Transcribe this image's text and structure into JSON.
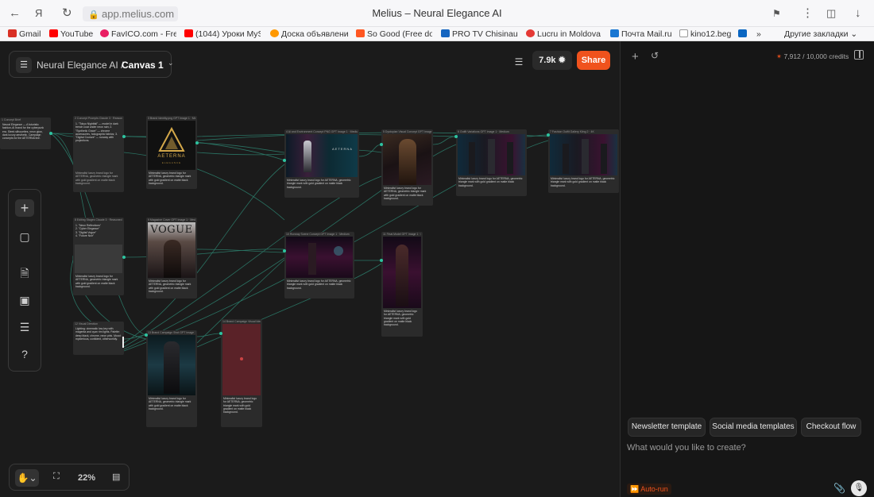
{
  "browser": {
    "url": "app.melius.com",
    "tab_title": "Melius – Neural Elegance AI",
    "bookmarks": [
      {
        "label": "Gmail",
        "color": "#d93025"
      },
      {
        "label": "YouTube",
        "color": "#ff0000"
      },
      {
        "label": "FavICO.com - Free",
        "color": "#e91e63"
      },
      {
        "label": "(1044) Уроки MyS",
        "color": "#ff0000"
      },
      {
        "label": "Доска объявлени",
        "color": "#ff9800"
      },
      {
        "label": "So Good (Free dov",
        "color": "#ff5722"
      },
      {
        "label": "PRO TV Chisinau |",
        "color": "#1565c0"
      },
      {
        "label": "Lucru in Moldova",
        "color": "#e53935"
      },
      {
        "label": "Почта Mail.ru",
        "color": "#1976d2"
      },
      {
        "label": "kino12.beg",
        "color": "#9e9e9e"
      },
      {
        "label": "",
        "color": "#0a66c2"
      }
    ],
    "more_bookmarks": "»",
    "other_bookmarks": "Другие закладки"
  },
  "header": {
    "project_name": "Neural Elegance AI /",
    "canvas_name": "Canvas 1",
    "credits_pill": "7.9k",
    "share_label": "Share"
  },
  "bottom_bar": {
    "zoom": "22%"
  },
  "right_panel": {
    "credits": "7,912 / 10,000 credits",
    "templates": [
      "Newsletter template",
      "Social media templates",
      "Checkout flow"
    ],
    "prompt_placeholder": "What would you like to create?",
    "autorun_label": "Auto-run"
  },
  "nodes": [
    {
      "name": "node-concept-brief",
      "header": "1 Concept Brief"
    },
    {
      "name": "node-concept-prompts",
      "header": "2 Concept Prompts    Claude 3 · Reasoned"
    },
    {
      "name": "node-brand-identity",
      "header": "3 Brand Identity.png    GPT Image 1 · Medium"
    },
    {
      "name": "node-cyber-character-1",
      "header": "4 Ai and Environment Concept PNG    GPT Image 1 · Medium"
    },
    {
      "name": "node-dystopian-visual",
      "header": "5 Dystopian Visual Concept    GPT Image 1 · Medium"
    },
    {
      "name": "node-outfit-variations-1",
      "header": "6 Outfit Variations    GPT Image 1 · Medium"
    },
    {
      "name": "node-outfit-variations-2",
      "header": "7 Fashion Outfit Gallery    Kling 2 · 4K"
    },
    {
      "name": "node-editing-stages",
      "header": "8 Editing Stages    Claude 3 · Reasoned"
    },
    {
      "name": "node-magazine-cover",
      "header": "9 Magazine Cover    GPT Image 1 · Medium"
    },
    {
      "name": "node-runway-scene",
      "header": "10 Runway Scene Concept    GPT Image 1 · Medium"
    },
    {
      "name": "node-final-look",
      "header": "11 Final Model    GPT Image 1 · Medium"
    },
    {
      "name": "node-visual-direction",
      "header": "12 Visual Direction"
    },
    {
      "name": "node-brand-campaign",
      "header": "13 Brand Campaign Shot    GPT Image 1 · Medium"
    },
    {
      "name": "node-brand-campaign-visual",
      "header": "14 Brand Campaign Visual    Ideo"
    }
  ],
  "node_texts": {
    "brief": "Neural Elegance — A futuristic fashion-AI brand for the cyberpunk era. Sleek silhouettes, neon glow, dark luxury aesthetic. Campaign concepts for the AETERNA line.",
    "concept": "1. \"Tokyo Nightfall\" — model in dark trench coat under neon rain; 2. \"Synthetic Grace\" — chrome accessories, holographic fabrics; 3. \"Digital Couture\" — runway with projections.",
    "editing": "1. \"Neon Reflections\"\n2. \"Cyber Elegance\"\n3. \"Digital Vogue\"\n4. \"Future Noir\"",
    "direction": "Lighting: cinematic low-key with magenta and cyan rim lights. Palette: deep black, chrome, neon pink. Mood: mysterious, confident, otherworldly.",
    "cover_caption": "AETERNA",
    "cover_sub": "ELEGANCE",
    "vogue": "VOGUE",
    "wordmark": "AETERNA",
    "caption_generic": "Minimalist luxury brand logo for AETERNA, geometric triangle mark with gold gradient on matte black background."
  }
}
